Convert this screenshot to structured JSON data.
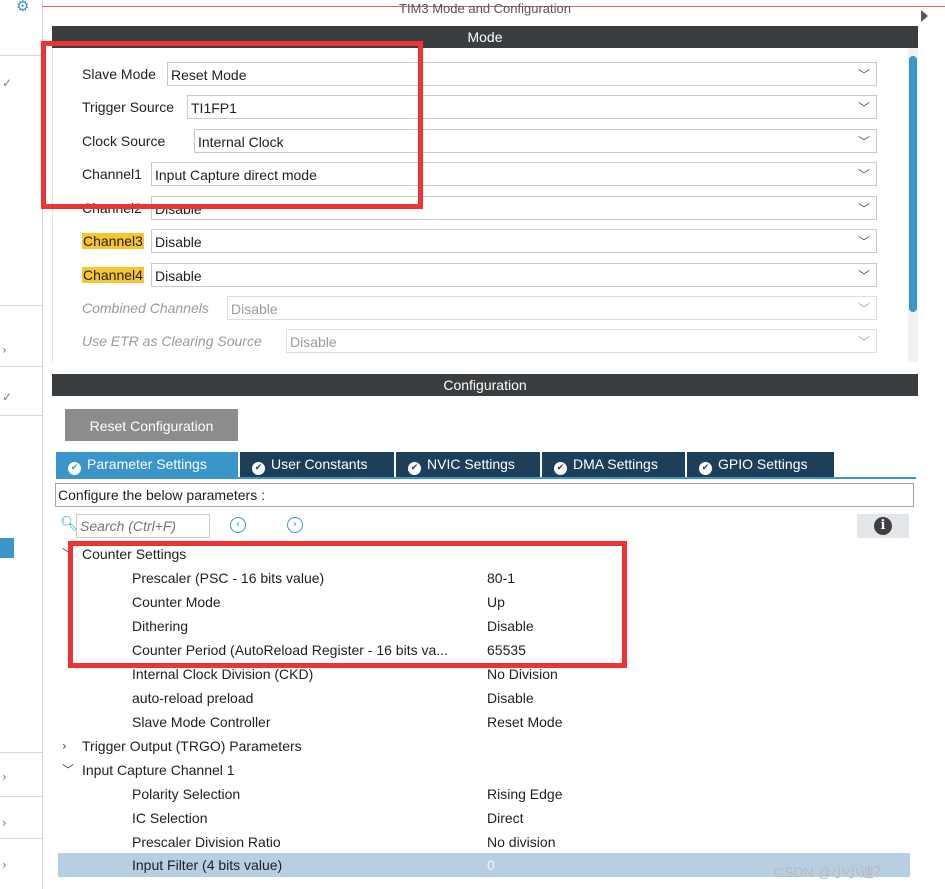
{
  "window": {
    "title": "TIM3 Mode and Configuration"
  },
  "mode": {
    "header": "Mode",
    "fields": [
      {
        "label": "Slave Mode",
        "value": "Reset Mode"
      },
      {
        "label": "Trigger Source",
        "value": "TI1FP1"
      },
      {
        "label": "Clock Source",
        "value": "Internal Clock"
      },
      {
        "label": "Channel1",
        "value": "Input Capture direct mode"
      },
      {
        "label": "Channel2",
        "value": "Disable"
      },
      {
        "label": "Channel3",
        "value": "Disable",
        "highlight": true
      },
      {
        "label": "Channel4",
        "value": "Disable",
        "highlight": true
      },
      {
        "label": "Combined Channels",
        "value": "Disable",
        "disabled": true
      },
      {
        "label": "Use ETR as Clearing Source",
        "value": "Disable",
        "disabled": true
      }
    ]
  },
  "configuration": {
    "header": "Configuration",
    "reset_button": "Reset Configuration",
    "tabs": [
      {
        "label": "Parameter Settings",
        "active": true
      },
      {
        "label": "User Constants"
      },
      {
        "label": "NVIC Settings"
      },
      {
        "label": "DMA Settings"
      },
      {
        "label": "GPIO Settings"
      }
    ],
    "instructions": "Configure the below parameters :",
    "search_placeholder": "Search (Ctrl+F)",
    "tree": [
      {
        "type": "group",
        "label": "Counter Settings",
        "expanded": true
      },
      {
        "type": "param",
        "name": "Prescaler (PSC - 16 bits value)",
        "value": "80-1"
      },
      {
        "type": "param",
        "name": "Counter Mode",
        "value": "Up"
      },
      {
        "type": "param",
        "name": "Dithering",
        "value": "Disable"
      },
      {
        "type": "param",
        "name": "Counter Period (AutoReload Register - 16 bits va...",
        "value": "65535"
      },
      {
        "type": "param",
        "name": "Internal Clock Division (CKD)",
        "value": "No Division"
      },
      {
        "type": "param",
        "name": "auto-reload preload",
        "value": "Disable"
      },
      {
        "type": "param",
        "name": "Slave Mode Controller",
        "value": "Reset Mode"
      },
      {
        "type": "group",
        "label": "Trigger Output (TRGO) Parameters",
        "expanded": false
      },
      {
        "type": "group",
        "label": "Input Capture Channel 1",
        "expanded": true
      },
      {
        "type": "param",
        "name": "Polarity Selection",
        "value": "Rising Edge"
      },
      {
        "type": "param",
        "name": "IC Selection",
        "value": "Direct"
      },
      {
        "type": "param",
        "name": "Prescaler Division Ratio",
        "value": "No division"
      },
      {
        "type": "param",
        "name": "Input Filter (4 bits value)",
        "value": "0",
        "selected": true
      }
    ]
  },
  "watermark": "CSDN @小小迪？",
  "colors": {
    "accent": "#3a95c9",
    "header_bg": "#3b3e40",
    "tab_bg": "#1e3f5a",
    "highlight": "#f7c530",
    "annotation": "#ee3333"
  }
}
